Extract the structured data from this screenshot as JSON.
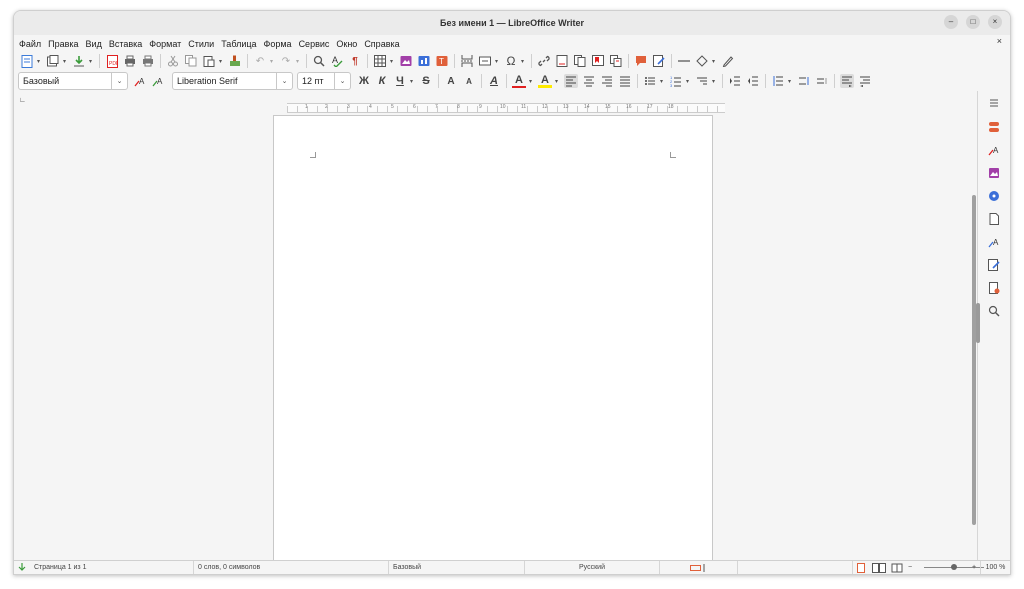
{
  "window": {
    "title": "Без имени 1 — LibreOffice Writer"
  },
  "window_buttons": {
    "minimize": "–",
    "maximize": "□",
    "close": "×"
  },
  "menu": [
    "Файл",
    "Правка",
    "Вид",
    "Вставка",
    "Формат",
    "Стили",
    "Таблица",
    "Форма",
    "Сервис",
    "Окно",
    "Справка"
  ],
  "menu_close": "×",
  "formatting": {
    "paragraph_style": "Базовый",
    "font_name": "Liberation Serif",
    "font_size": "12 пт",
    "bold": "Ж",
    "italic": "К",
    "underline": "Ч",
    "strikethrough": "S",
    "superscript": "A",
    "subscript": "A",
    "clear_format": "A",
    "font_color": "A",
    "highlight": "A"
  },
  "special_char": "Ω",
  "ruler_numbers": [
    "1",
    "2",
    "3",
    "4",
    "5",
    "6",
    "7",
    "8",
    "9",
    "10",
    "11",
    "12",
    "13",
    "14",
    "15",
    "16",
    "17",
    "18"
  ],
  "status": {
    "page": "Страница 1 из 1",
    "words": "0 слов, 0 символов",
    "page_style": "Базовый",
    "language": "Русский",
    "zoom": "100 %",
    "zoom_minus": "−",
    "zoom_plus": "+"
  },
  "colors": {
    "accent_red": "#e02020",
    "highlight_yellow": "#ffeb00",
    "sidebar_blue": "#3b6fd8",
    "doc_icon": "#3c7bd9"
  }
}
